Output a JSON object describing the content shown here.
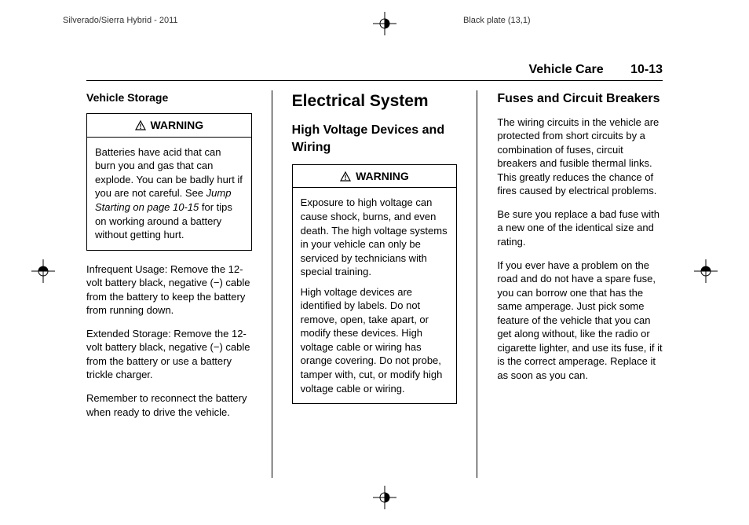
{
  "topHeader": {
    "left": "Silverado/Sierra Hybrid - 2011",
    "right": "Black plate (13,1)"
  },
  "sectionHeader": {
    "title": "Vehicle Care",
    "number": "10-13"
  },
  "column1": {
    "heading": "Vehicle Storage",
    "warning": {
      "label": "WARNING",
      "bodyStart": "Batteries have acid that can burn you and gas that can explode. You can be badly hurt if you are not careful. See ",
      "bodyItalic": "Jump Starting on page 10‑15",
      "bodyEnd": " for tips on working around a battery without getting hurt."
    },
    "para1": "Infrequent Usage: Remove the 12-volt battery black, negative (−) cable from the battery to keep the battery from running down.",
    "para2": "Extended Storage: Remove the 12-volt battery black, negative (−) cable from the battery or use a battery trickle charger.",
    "para3": "Remember to reconnect the battery when ready to drive the vehicle."
  },
  "column2": {
    "mainHeading": "Electrical System",
    "subHeading": "High Voltage Devices and Wiring",
    "warning": {
      "label": "WARNING",
      "para1": "Exposure to high voltage can cause shock, burns, and even death. The high voltage systems in your vehicle can only be serviced by technicians with special training.",
      "para2": "High voltage devices are identified by labels. Do not remove, open, take apart, or modify these devices. High voltage cable or wiring has orange covering. Do not probe, tamper with, cut, or modify high voltage cable or wiring."
    }
  },
  "column3": {
    "heading": "Fuses and Circuit Breakers",
    "para1": "The wiring circuits in the vehicle are protected from short circuits by a combination of fuses, circuit breakers and fusible thermal links. This greatly reduces the chance of fires caused by electrical problems.",
    "para2": "Be sure you replace a bad fuse with a new one of the identical size and rating.",
    "para3": "If you ever have a problem on the road and do not have a spare fuse, you can borrow one that has the same amperage. Just pick some feature of the vehicle that you can get along without, like the radio or cigarette lighter, and use its fuse, if it is the correct amperage. Replace it as soon as you can."
  }
}
